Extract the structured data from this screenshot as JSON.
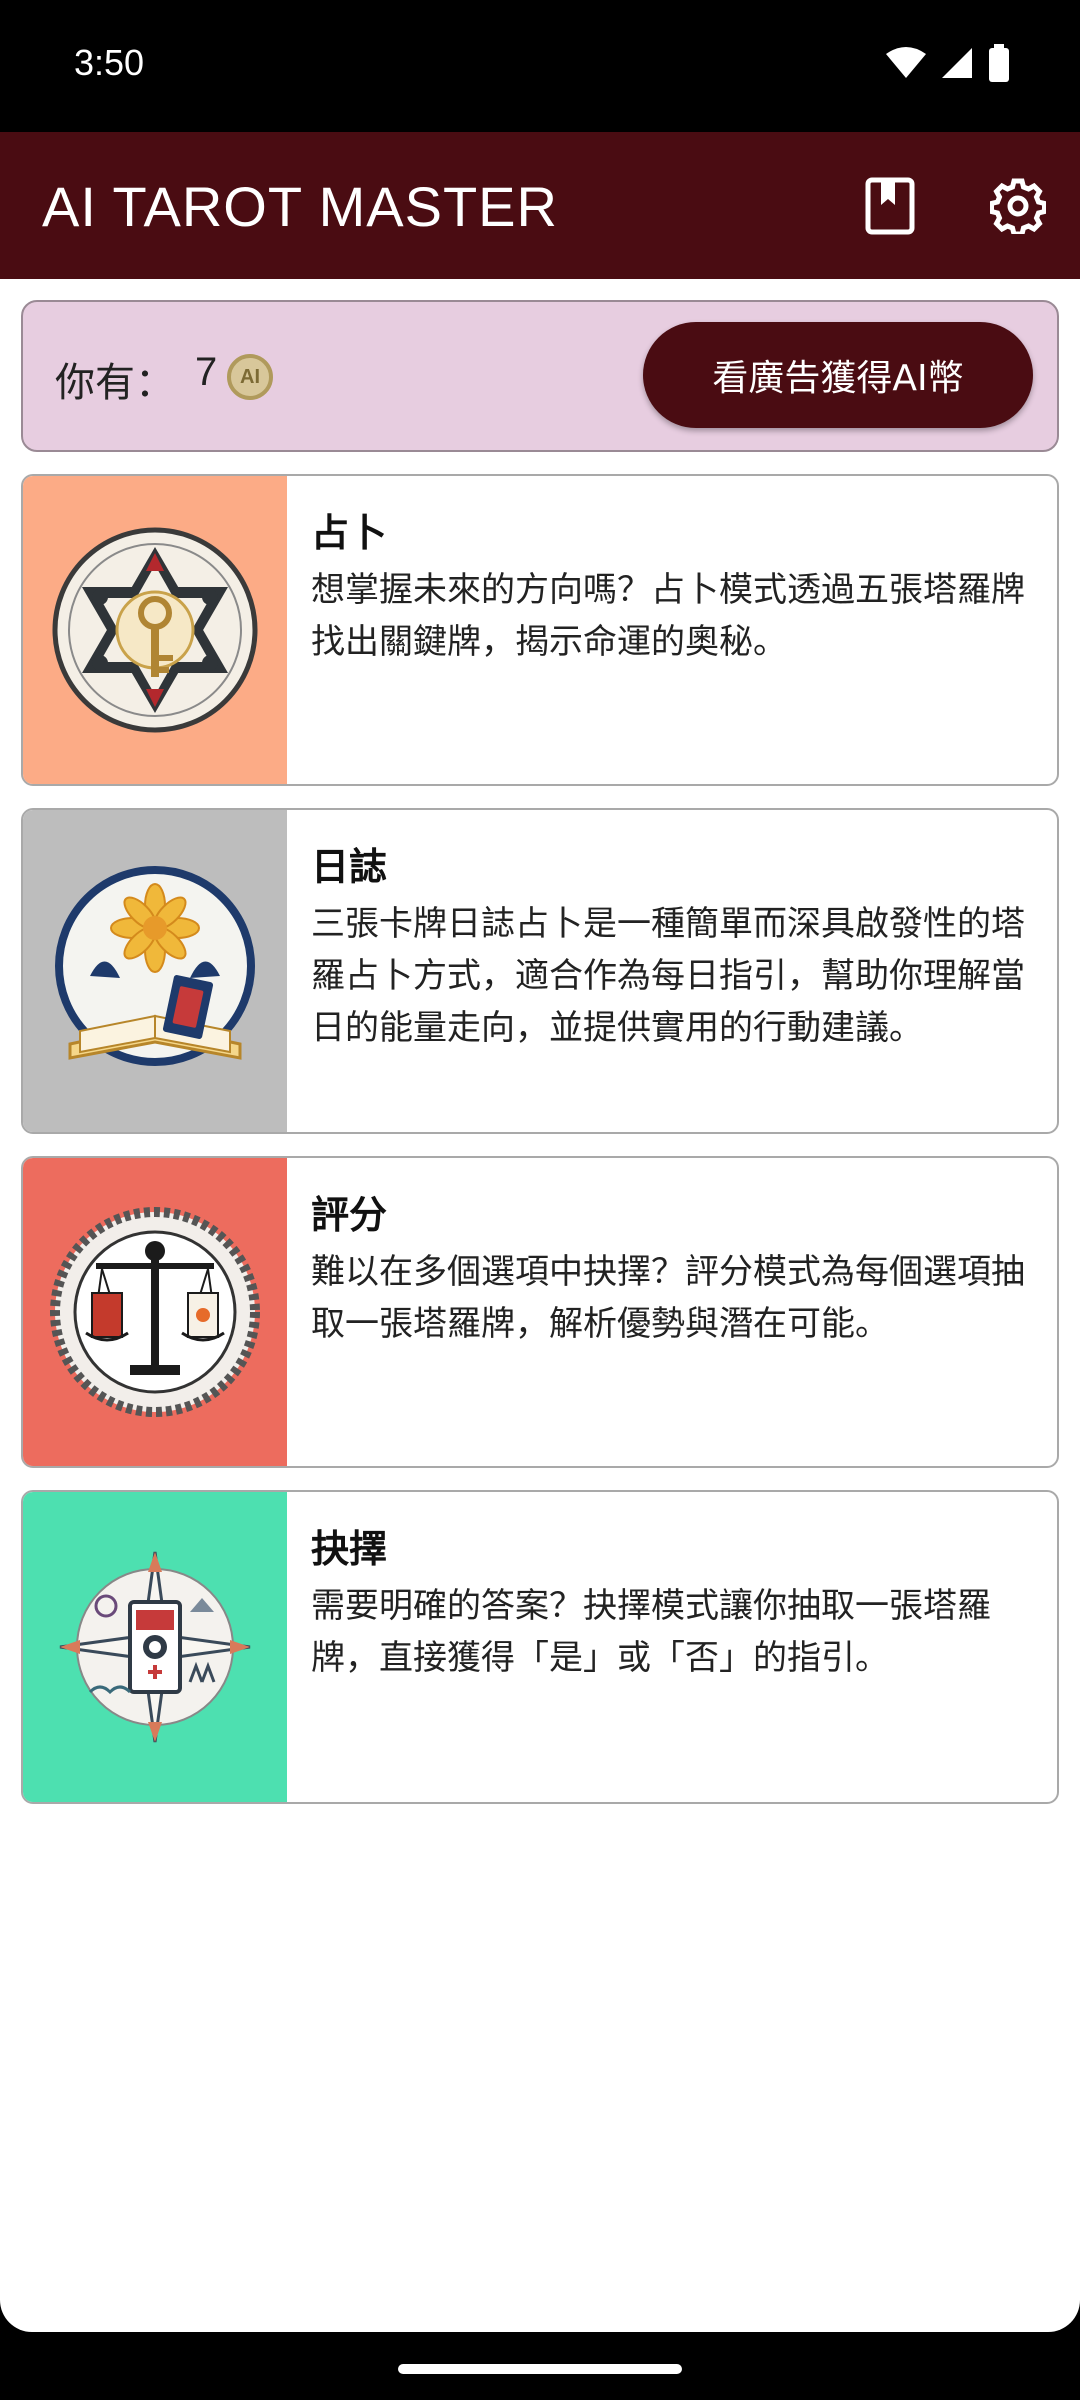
{
  "status_bar": {
    "time": "3:50"
  },
  "app_bar": {
    "title": "AI TAROT MASTER",
    "bookmark_icon": "bookmark-icon",
    "settings_icon": "gear-icon"
  },
  "coins": {
    "label": "你有：",
    "count": "7",
    "coin_icon_text": "AI",
    "ad_button_label": "看廣告獲得AI幣"
  },
  "modes": [
    {
      "title": "占卜",
      "description": "想掌握未來的方向嗎？占卜模式透過五張塔羅牌找出關鍵牌，揭示命運的奧秘。",
      "color": "#fcab86"
    },
    {
      "title": "日誌",
      "description": "三張卡牌日誌占卜是一種簡單而深具啟發性的塔羅占卜方式，適合作為每日指引，幫助你理解當日的能量走向，並提供實用的行動建議。",
      "color": "#bdbdbd"
    },
    {
      "title": "評分",
      "description": "難以在多個選項中抉擇？評分模式為每個選項抽取一張塔羅牌，解析優勢與潛在可能。",
      "color": "#ed6c5e"
    },
    {
      "title": "抉擇",
      "description": "需要明確的答案？抉擇模式讓你抽取一張塔羅牌，直接獲得「是」或「否」的指引。",
      "color": "#4de0b0"
    }
  ],
  "colors": {
    "app_bar": "#4a0c12",
    "coin_card": "#e7cde0"
  }
}
